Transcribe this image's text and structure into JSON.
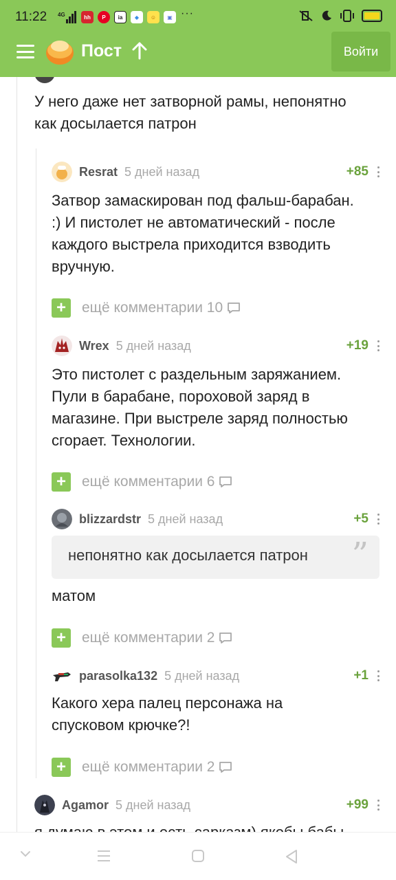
{
  "status": {
    "time": "11:22",
    "network": "4G"
  },
  "colors": {
    "brand_green": "#8ac858",
    "rating_green": "#6aa23c",
    "muted_text": "#a8a8a8"
  },
  "header": {
    "title": "Пост",
    "login_label": "Войти"
  },
  "comments": [
    {
      "text_lines": [
        "У него даже нет затворной рамы, непонятно",
        "как досылается патрон"
      ]
    },
    {
      "author": "Resrat",
      "time": "5 дней назад",
      "rating": "+85",
      "text_lines": [
        "Затвор замаскирован под фальш-барабан.",
        ":) И пистолет не автоматический - после",
        "каждого выстрела приходится взводить",
        "вручную."
      ],
      "more": "ещё комментарии 10"
    },
    {
      "author": "Wrex",
      "time": "5 дней назад",
      "rating": "+19",
      "text_lines": [
        "Это пистолет с раздельным заряжанием.",
        "Пули в барабане, пороховой заряд в",
        "магазине. При выстреле заряд полностью",
        "сгорает. Технологии."
      ],
      "more": "ещё комментарии 6"
    },
    {
      "author": "blizzardstr",
      "time": "5 дней назад",
      "rating": "+5",
      "quote": "непонятно как досылается патрон",
      "text_lines": [
        "матом"
      ],
      "more": "ещё комментарии 2"
    },
    {
      "author": "parasolka132",
      "time": "5 дней назад",
      "rating": "+1",
      "text_lines": [
        "Какого хера палец персонажа на",
        "спусковом крючке?!"
      ],
      "more": "ещё комментарии 2"
    },
    {
      "author": "Agamor",
      "time": "5 дней назад",
      "rating": "+99",
      "text_lines": [
        "я думаю в этом и есть сарказм) якобы бабы"
      ]
    }
  ]
}
